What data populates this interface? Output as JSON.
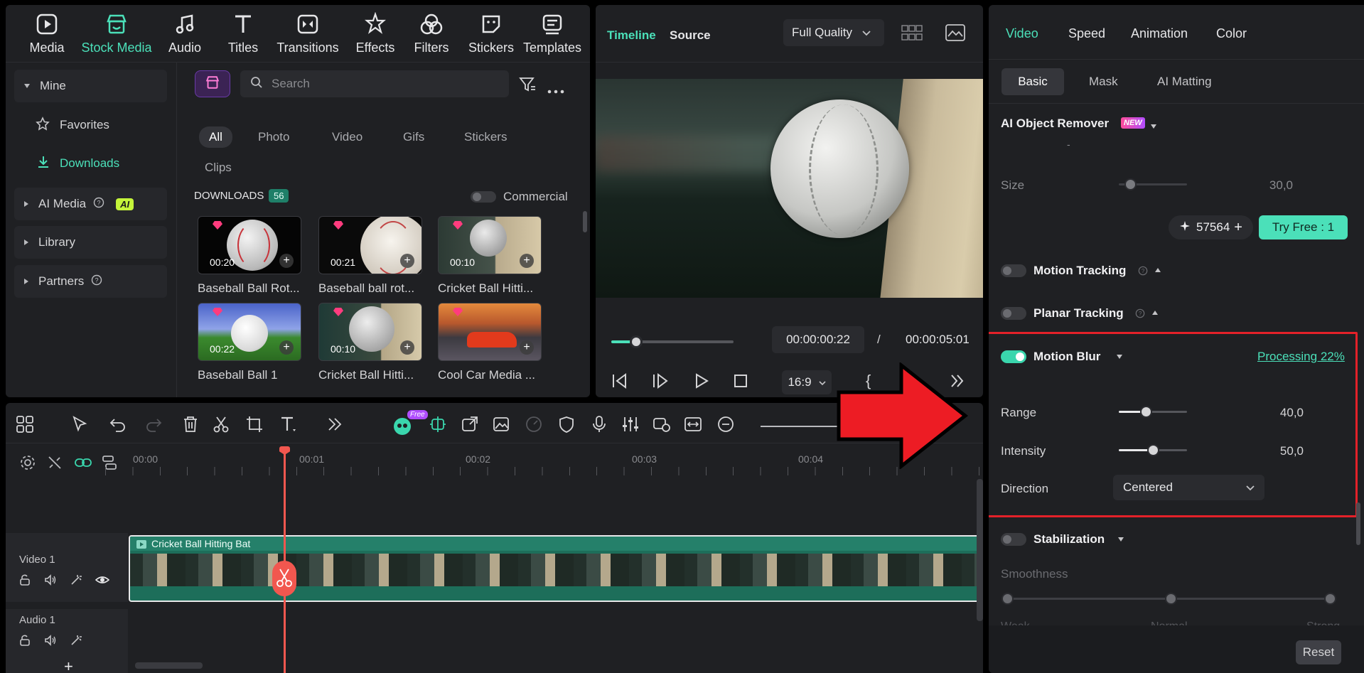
{
  "media_tabs": [
    {
      "label": "Media",
      "icon": "media-icon"
    },
    {
      "label": "Stock Media",
      "icon": "stock-media-icon",
      "active": true
    },
    {
      "label": "Audio",
      "icon": "audio-icon"
    },
    {
      "label": "Titles",
      "icon": "titles-icon"
    },
    {
      "label": "Transitions",
      "icon": "transitions-icon"
    },
    {
      "label": "Effects",
      "icon": "effects-icon"
    },
    {
      "label": "Filters",
      "icon": "filters-icon"
    },
    {
      "label": "Stickers",
      "icon": "stickers-icon"
    },
    {
      "label": "Templates",
      "icon": "templates-icon"
    }
  ],
  "sidebar": {
    "mine": "Mine",
    "favorites": "Favorites",
    "downloads": "Downloads",
    "ai_media": "AI Media",
    "ai_badge": "AI",
    "library": "Library",
    "partners": "Partners"
  },
  "search": {
    "placeholder": "Search"
  },
  "filters": [
    "All",
    "Photo",
    "Video",
    "Gifs",
    "Stickers",
    "Clips"
  ],
  "downloads": {
    "heading": "DOWNLOADS",
    "count": "56",
    "commercial": "Commercial"
  },
  "thumbs": [
    {
      "duration": "00:20",
      "label": "Baseball Ball Rot..."
    },
    {
      "duration": "00:21",
      "label": "Baseball ball rot..."
    },
    {
      "duration": "00:10",
      "label": "Cricket Ball Hitti..."
    },
    {
      "duration": "00:22",
      "label": "Baseball Ball 1"
    },
    {
      "duration": "00:10",
      "label": "Cricket Ball Hitti..."
    },
    {
      "duration": "",
      "label": "Cool Car Media ..."
    }
  ],
  "preview": {
    "tab_timeline": "Timeline",
    "tab_source": "Source",
    "quality": "Full Quality",
    "current_time": "00:00:00:22",
    "separator": "/",
    "total_time": "00:00:05:01",
    "aspect": "16:9",
    "progress": 0.2
  },
  "props": {
    "tabs": [
      "Video",
      "Speed",
      "Animation",
      "Color"
    ],
    "subtabs": [
      "Basic",
      "Mask",
      "AI Matting"
    ],
    "ai_object_remover": "AI Object Remover",
    "new_badge": "NEW",
    "dash": "-",
    "size_label": "Size",
    "size_value": "30,0",
    "credits": "57564",
    "try_free": "Try Free : 1",
    "motion_tracking": "Motion Tracking",
    "planar_tracking": "Planar Tracking",
    "motion_blur": "Motion Blur",
    "processing": "Processing 22%",
    "range_label": "Range",
    "range_value": "40,0",
    "intensity_label": "Intensity",
    "intensity_value": "50,0",
    "direction_label": "Direction",
    "direction_value": "Centered",
    "stabilization": "Stabilization",
    "smoothness": "Smoothness",
    "weak": "Weak",
    "normal": "Normal",
    "strong": "Strong",
    "reset": "Reset",
    "range_level": 0.4,
    "intensity_level": 0.5
  },
  "timeline": {
    "ruler": [
      "00:00",
      "00:01",
      "00:02",
      "00:03",
      "00:04"
    ],
    "video_track": "Video 1",
    "audio_track": "Audio 1",
    "clip_name": "Cricket Ball Hitting Bat",
    "free_badge": "Free"
  },
  "colors": {
    "accent": "#4be0b9",
    "highlight": "#e32129",
    "arrow": "#ed1c24"
  }
}
